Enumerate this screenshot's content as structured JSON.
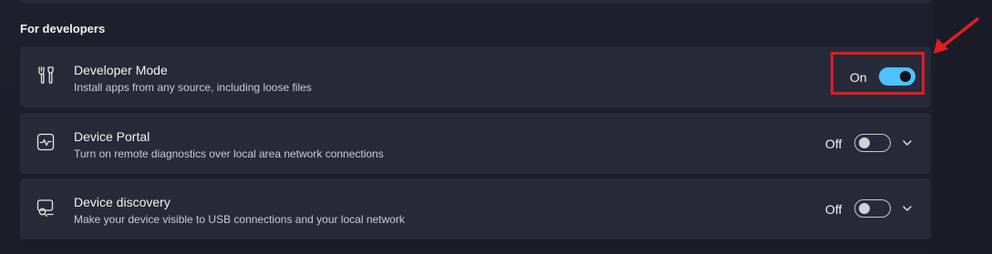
{
  "section": {
    "title": "For developers"
  },
  "cards": [
    {
      "title": "Developer Mode",
      "description": "Install apps from any source, including loose files",
      "state_label": "On",
      "toggle_on": true,
      "icon": "tools-icon"
    },
    {
      "title": "Device Portal",
      "description": "Turn on remote diagnostics over local area network connections",
      "state_label": "Off",
      "toggle_on": false,
      "icon": "activity-monitor-icon"
    },
    {
      "title": "Device discovery",
      "description": "Make your device visible to USB connections and your local network",
      "state_label": "Off",
      "toggle_on": false,
      "icon": "device-search-icon"
    }
  ],
  "colors": {
    "accent": "#4cc2ff",
    "annotation": "#e41c23",
    "card_bg": "#272b39",
    "page_bg": "#1c1f2b"
  }
}
